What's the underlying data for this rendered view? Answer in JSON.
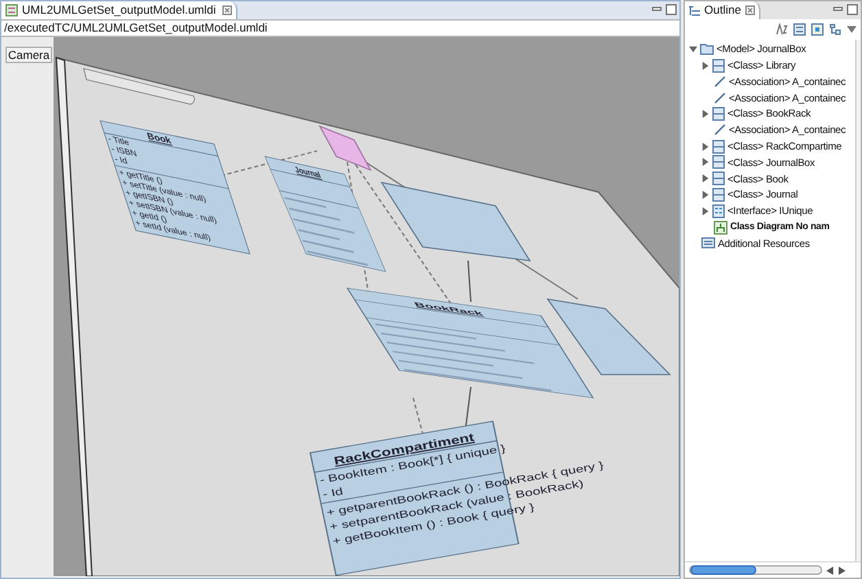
{
  "editor": {
    "tab_title": "UML2UMLGetSet_outputModel.umldi",
    "path": "/executedTC/UML2UMLGetSet_outputModel.umldi",
    "camera_button": "Camera",
    "diagram": {
      "classes": [
        {
          "name": "Book",
          "attributes": [
            "- Title",
            "- ISBN",
            "- Id"
          ],
          "operations": [
            "+ getTitle ()",
            "+ setTitle (value : null)",
            "+ getISBN ()",
            "+ setISBN (value : null)",
            "+ getId ()",
            "+ setId (value : null)"
          ]
        },
        {
          "name": "Journal"
        },
        {
          "name": "BookRack"
        },
        {
          "name": "RackCompartiment",
          "attributes": [
            "- BookItem : Book[*] { unique }",
            "- Id"
          ],
          "operations": [
            "+ getparentBookRack () : BookRack { query }",
            "+ setparentBookRack (value : BookRack)",
            "+ getBookItem () : Book { query }"
          ]
        }
      ]
    }
  },
  "outline": {
    "title": "Outline",
    "tree": [
      {
        "kind": "model",
        "label": "<Model> JournalBox",
        "expanded": true,
        "children": [
          {
            "kind": "class",
            "label": "<Class> Library",
            "expanded": false
          },
          {
            "kind": "association",
            "label": "<Association> A_containec"
          },
          {
            "kind": "association",
            "label": "<Association> A_containec"
          },
          {
            "kind": "class",
            "label": "<Class> BookRack",
            "expanded": false
          },
          {
            "kind": "association",
            "label": "<Association> A_containec"
          },
          {
            "kind": "class",
            "label": "<Class> RackCompartime",
            "expanded": false
          },
          {
            "kind": "class",
            "label": "<Class> JournalBox",
            "expanded": false
          },
          {
            "kind": "class",
            "label": "<Class> Book",
            "expanded": false
          },
          {
            "kind": "class",
            "label": "<Class> Journal",
            "expanded": false
          },
          {
            "kind": "interface",
            "label": "<Interface> IUnique",
            "expanded": false
          },
          {
            "kind": "diagram",
            "label": "Class Diagram No nam"
          }
        ]
      },
      {
        "kind": "resources",
        "label": "Additional Resources"
      }
    ]
  }
}
